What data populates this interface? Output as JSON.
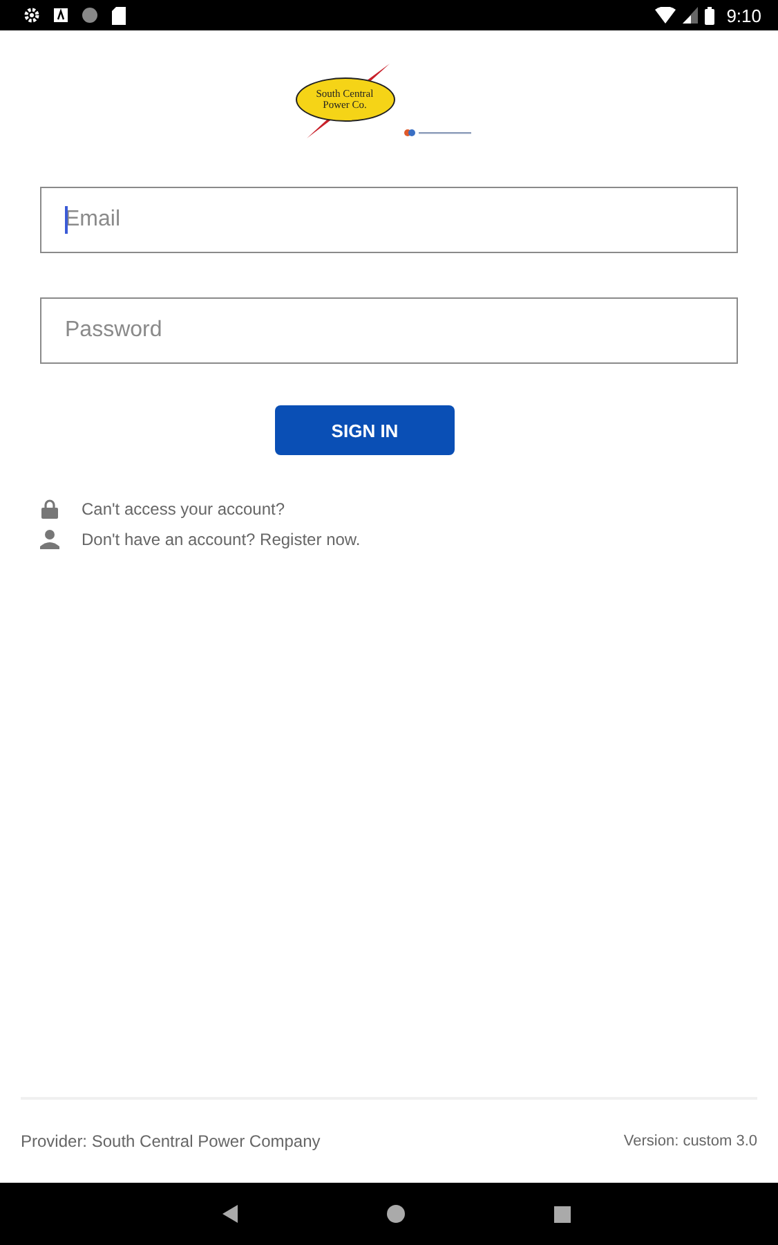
{
  "status_bar": {
    "time": "9:10"
  },
  "logo": {
    "text": "South Central Power Co."
  },
  "email": {
    "placeholder": "Email",
    "focused": true
  },
  "password": {
    "placeholder": "Password"
  },
  "sign_in_button": "SIGN IN",
  "links": [
    {
      "kind": "lock",
      "text": "Can't access your account?"
    },
    {
      "kind": "person",
      "text": "Don't have an account? Register now."
    }
  ],
  "footer": {
    "provider": "Provider: South Central Power Company",
    "version": "Version: custom 3.0"
  }
}
